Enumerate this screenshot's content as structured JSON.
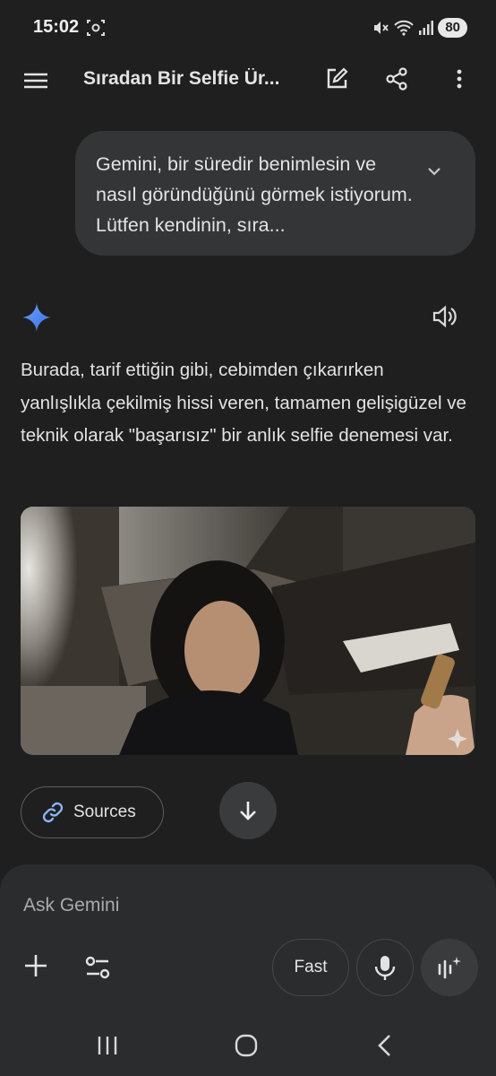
{
  "status_bar": {
    "time": "15:02",
    "battery": "80"
  },
  "app_bar": {
    "title": "Sıradan Bir Selfie Ür..."
  },
  "prompt": {
    "text": "Gemini, bir süredir benimlesin ve nasıl göründüğünü görmek istiyorum. Lütfen kendinin, sıra..."
  },
  "response": {
    "text": "Burada, tarif ettiğin gibi, cebimden çıkarırken yanlışlıkla çekilmiş hissi veren, tamamen gelişigüzel ve teknik olarak \"başarısız\" bir anlık selfie denemesi var."
  },
  "sources": {
    "label": "Sources"
  },
  "composer": {
    "placeholder": "Ask Gemini",
    "mode_label": "Fast"
  },
  "colors": {
    "background": "#1f1f1f",
    "bubble": "#333537",
    "composer": "#2b2c2e",
    "gemini_blue": "#4f8df5"
  },
  "icons": [
    "menu-icon",
    "edit-icon",
    "share-icon",
    "more-vert-icon",
    "chevron-down-icon",
    "gemini-spark-icon",
    "speaker-icon",
    "link-icon",
    "arrow-down-icon",
    "plus-icon",
    "tools-icon",
    "mic-icon",
    "live-icon"
  ]
}
